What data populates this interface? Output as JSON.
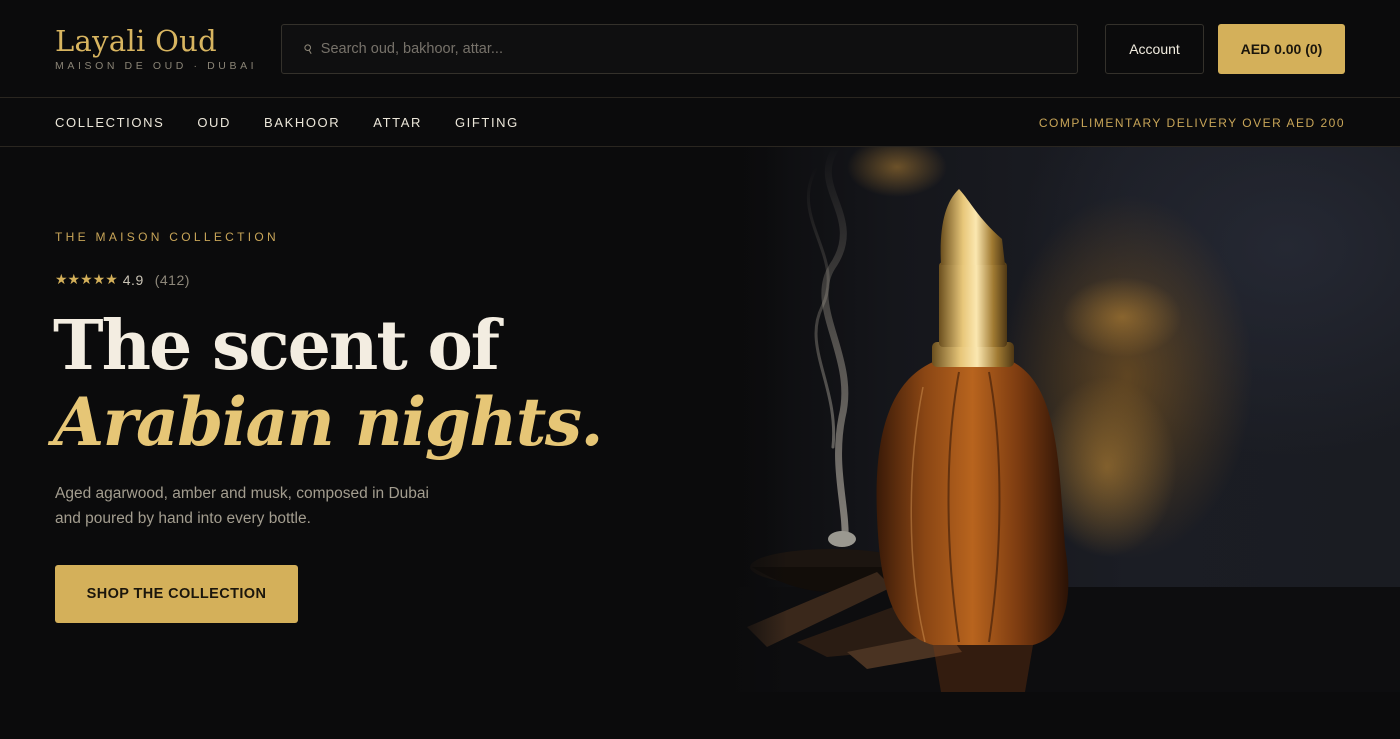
{
  "brand": {
    "name": "Layali Oud",
    "tagline": "MAISON DE OUD · DUBAI"
  },
  "search": {
    "placeholder": "Search oud, bakhoor, attar...",
    "value": ""
  },
  "header": {
    "account_label": "Account",
    "cart_label": "AED 0.00 (0)"
  },
  "nav": {
    "items": [
      {
        "label": "COLLECTIONS"
      },
      {
        "label": "OUD"
      },
      {
        "label": "BAKHOOR"
      },
      {
        "label": "ATTAR"
      },
      {
        "label": "GIFTING"
      }
    ],
    "promo": "COMPLIMENTARY DELIVERY OVER AED 200"
  },
  "hero": {
    "eyebrow": "THE MAISON COLLECTION",
    "stars": "★★★★★",
    "rating": "4.9",
    "review_count": "(412)",
    "headline_line1": "The scent of",
    "headline_line2": "Arabian nights.",
    "description": "Aged agarwood, amber and musk, composed in Dubai and poured by hand into every bottle.",
    "cta_label": "SHOP THE COLLECTION"
  },
  "colors": {
    "background": "#0b0b0c",
    "gold": "#d4b05a",
    "gold_text": "#c8a558",
    "headline_italic": "#e6c676"
  }
}
